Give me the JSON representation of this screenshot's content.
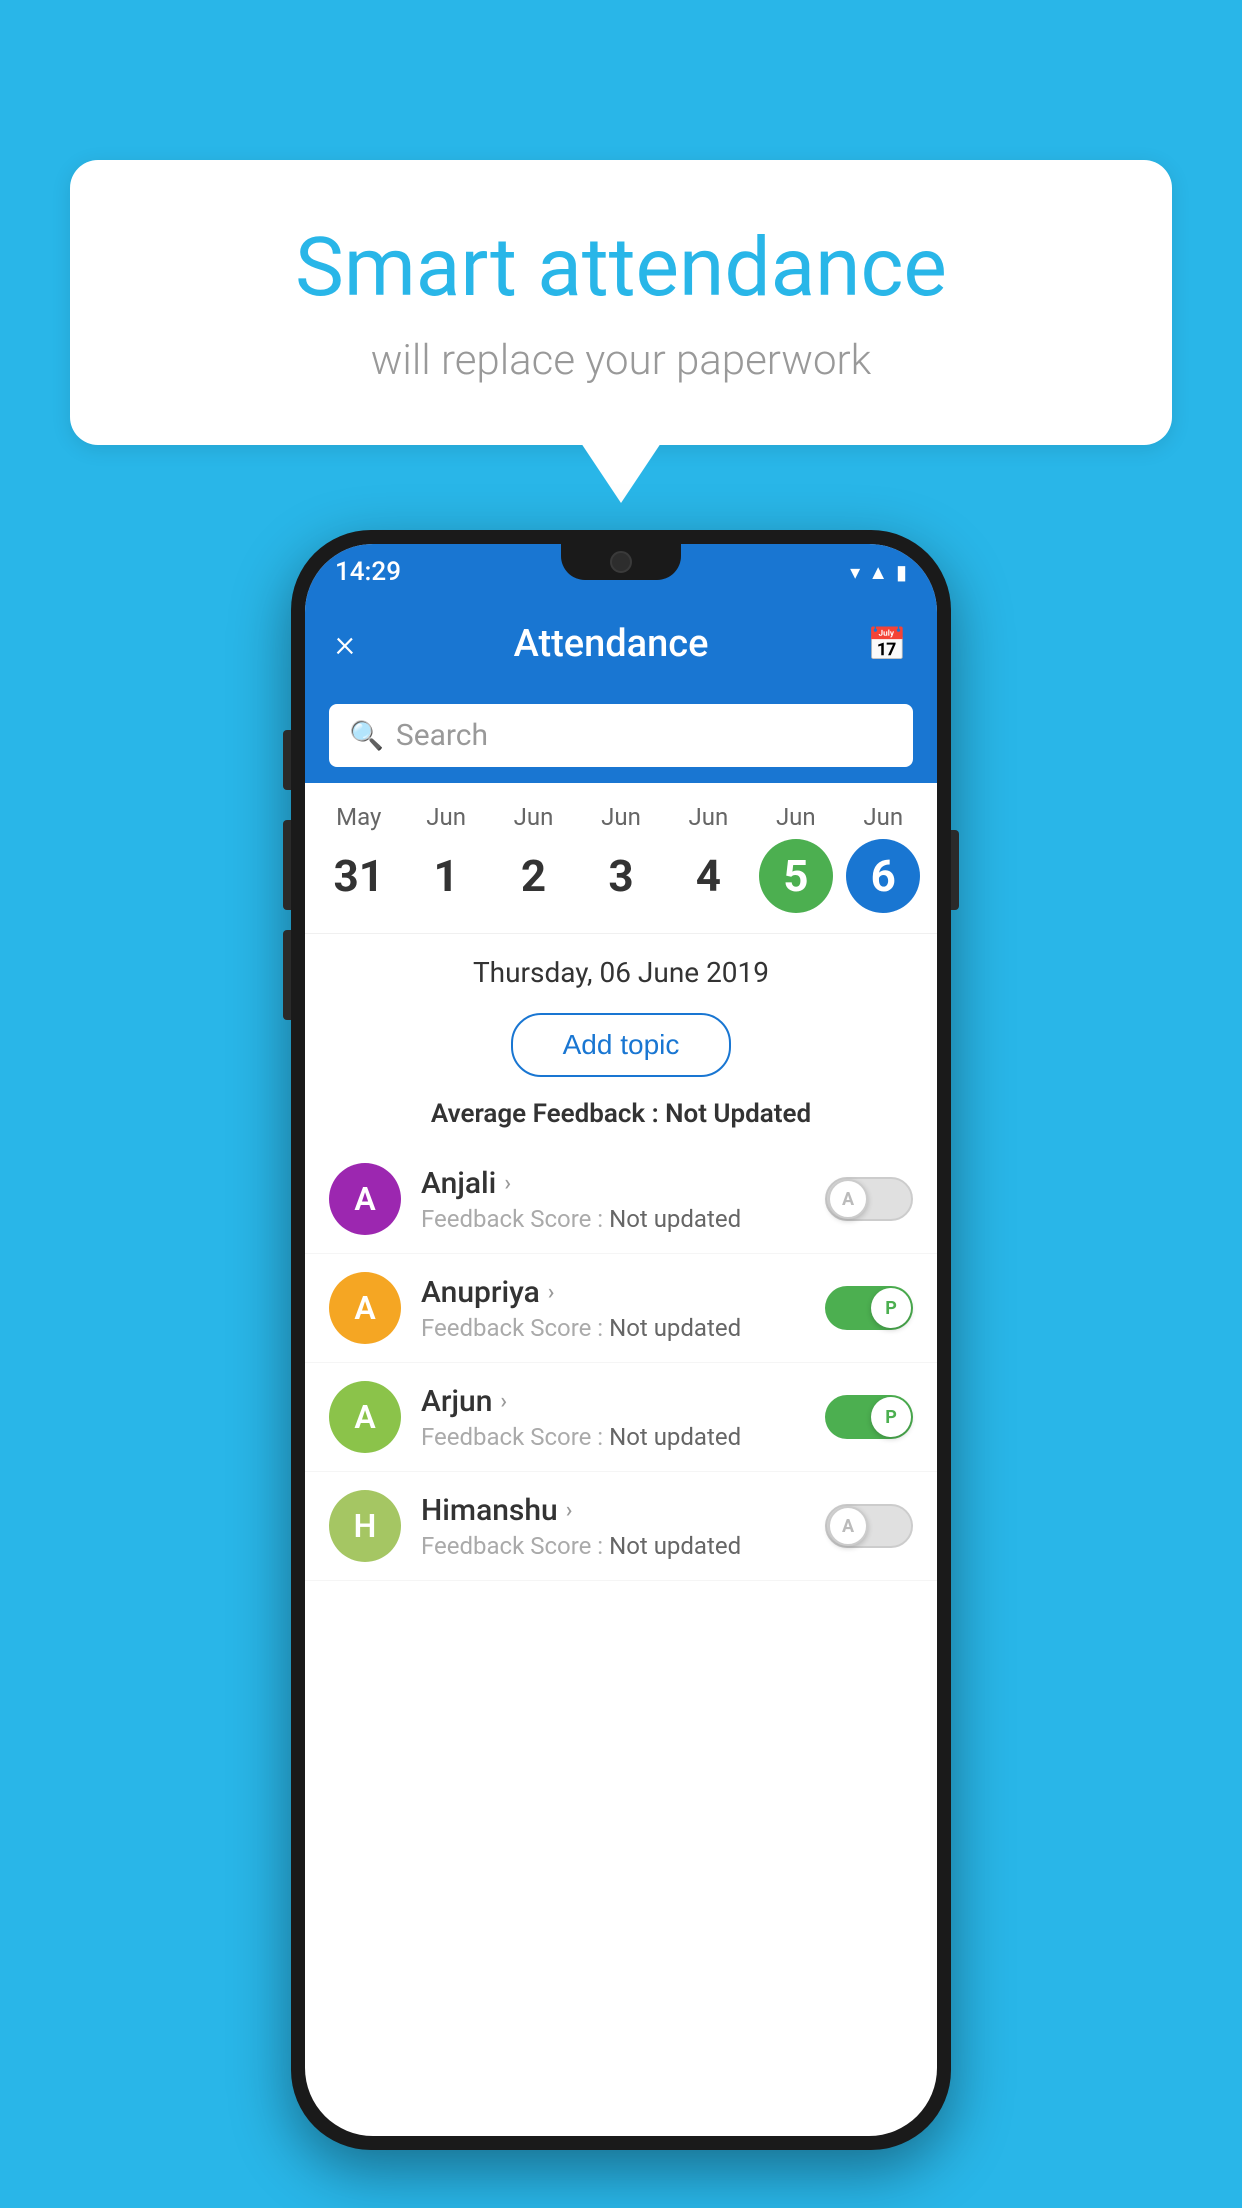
{
  "background": {
    "color": "#29b6e8"
  },
  "bubble": {
    "title": "Smart attendance",
    "subtitle": "will replace your paperwork"
  },
  "status_bar": {
    "time": "14:29",
    "icons": [
      "wifi",
      "signal",
      "battery"
    ]
  },
  "app_header": {
    "title": "Attendance",
    "close_label": "×",
    "calendar_label": "📅"
  },
  "search": {
    "placeholder": "Search"
  },
  "calendar": {
    "days": [
      {
        "month": "May",
        "date": "31",
        "state": "normal"
      },
      {
        "month": "Jun",
        "date": "1",
        "state": "normal"
      },
      {
        "month": "Jun",
        "date": "2",
        "state": "normal"
      },
      {
        "month": "Jun",
        "date": "3",
        "state": "normal"
      },
      {
        "month": "Jun",
        "date": "4",
        "state": "normal"
      },
      {
        "month": "Jun",
        "date": "5",
        "state": "today"
      },
      {
        "month": "Jun",
        "date": "6",
        "state": "selected"
      }
    ]
  },
  "selected_date": "Thursday, 06 June 2019",
  "add_topic_label": "Add topic",
  "avg_feedback_label": "Average Feedback :",
  "avg_feedback_value": "Not Updated",
  "students": [
    {
      "name": "Anjali",
      "initial": "A",
      "avatar_color": "#9c27b0",
      "feedback_label": "Feedback Score :",
      "feedback_value": "Not updated",
      "toggle_state": "off",
      "toggle_label": "A"
    },
    {
      "name": "Anupriya",
      "initial": "A",
      "avatar_color": "#f5a623",
      "feedback_label": "Feedback Score :",
      "feedback_value": "Not updated",
      "toggle_state": "on",
      "toggle_label": "P"
    },
    {
      "name": "Arjun",
      "initial": "A",
      "avatar_color": "#8bc34a",
      "feedback_label": "Feedback Score :",
      "feedback_value": "Not updated",
      "toggle_state": "on",
      "toggle_label": "P"
    },
    {
      "name": "Himanshu",
      "initial": "H",
      "avatar_color": "#a5c663",
      "feedback_label": "Feedback Score :",
      "feedback_value": "Not updated",
      "toggle_state": "off",
      "toggle_label": "A"
    }
  ]
}
